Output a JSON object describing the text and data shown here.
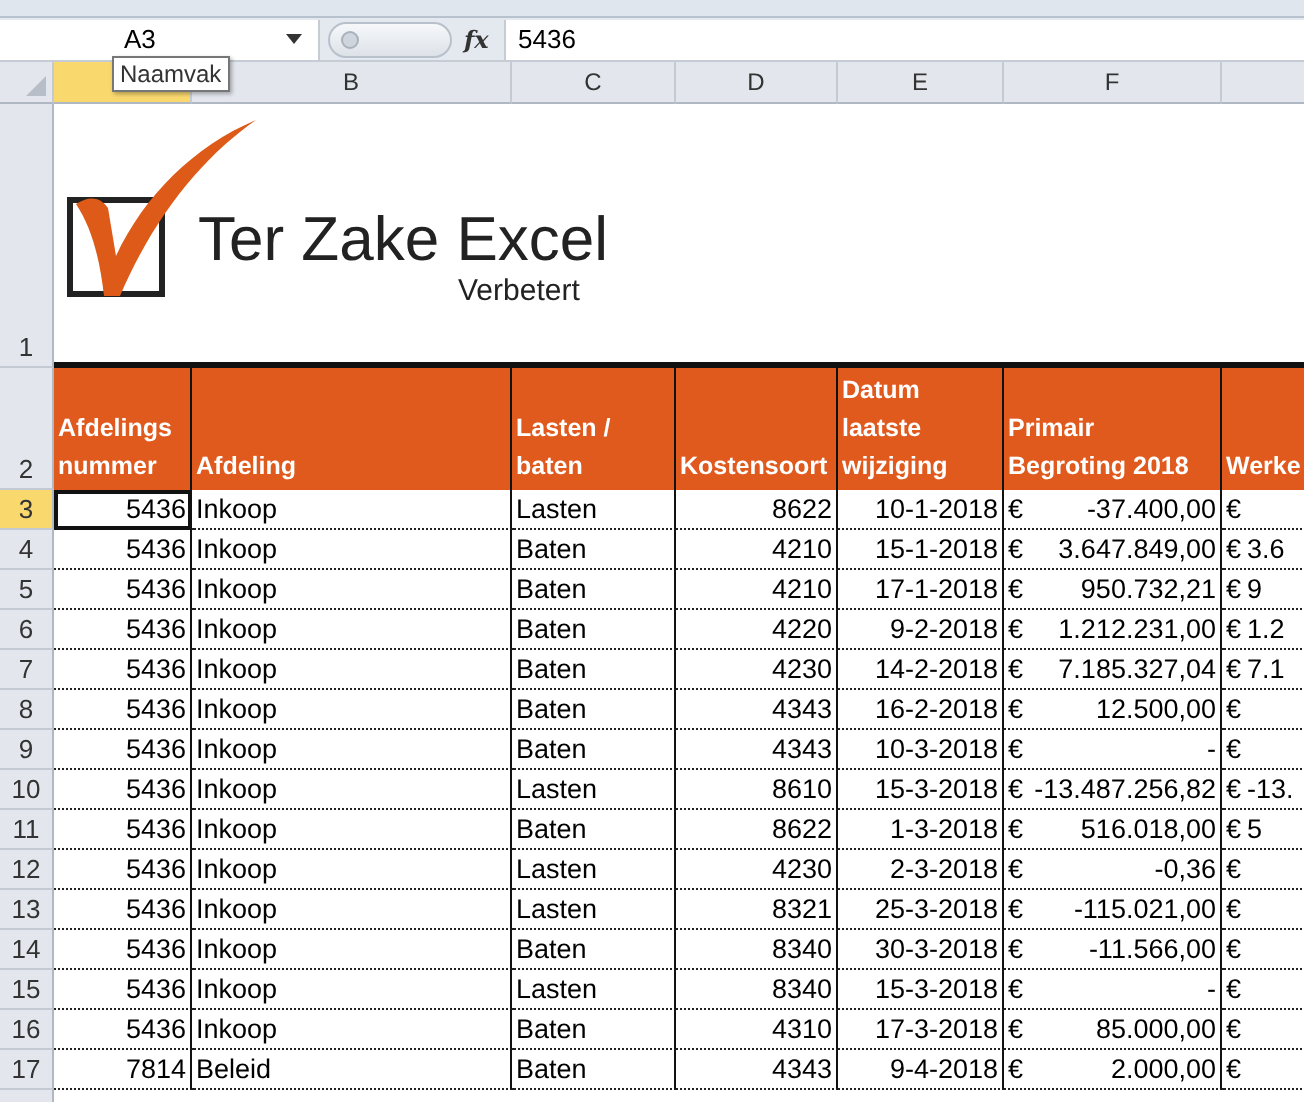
{
  "formula_bar": {
    "name_box": "A3",
    "function_label": "fx",
    "value": "5436"
  },
  "tooltip": "Naamvak",
  "columns": [
    {
      "selected": true
    },
    {
      "label": "B",
      "selected": false
    },
    {
      "label": "C",
      "selected": false
    },
    {
      "label": "D",
      "selected": false
    },
    {
      "label": "E",
      "selected": false
    },
    {
      "label": "F",
      "selected": false
    }
  ],
  "logo": {
    "row_number": "1",
    "title": "Ter Zake Excel",
    "tagline": "Verbetert"
  },
  "header_row": {
    "row_number": "2",
    "cells": [
      "Afdelings\nnummer",
      "Afdeling",
      "Lasten /\nbaten",
      "Kostensoort",
      "Datum\nlaatste\nwijziging",
      "Primair\nBegroting 2018",
      "Werke"
    ]
  },
  "rows": [
    {
      "number": "3",
      "selected": true,
      "cells": [
        "5436",
        "Inkoop",
        "Lasten",
        "8622",
        "10-1-2018",
        "€",
        "-37.400,00",
        "€",
        ""
      ]
    },
    {
      "number": "4",
      "selected": false,
      "cells": [
        "5436",
        "Inkoop",
        "Baten",
        "4210",
        "15-1-2018",
        "€",
        "3.647.849,00",
        "€",
        "3.6"
      ]
    },
    {
      "number": "5",
      "selected": false,
      "cells": [
        "5436",
        "Inkoop",
        "Baten",
        "4210",
        "17-1-2018",
        "€",
        "950.732,21",
        "€",
        "9"
      ]
    },
    {
      "number": "6",
      "selected": false,
      "cells": [
        "5436",
        "Inkoop",
        "Baten",
        "4220",
        "9-2-2018",
        "€",
        "1.212.231,00",
        "€",
        "1.2"
      ]
    },
    {
      "number": "7",
      "selected": false,
      "cells": [
        "5436",
        "Inkoop",
        "Baten",
        "4230",
        "14-2-2018",
        "€",
        "7.185.327,04",
        "€",
        "7.1"
      ]
    },
    {
      "number": "8",
      "selected": false,
      "cells": [
        "5436",
        "Inkoop",
        "Baten",
        "4343",
        "16-2-2018",
        "€",
        "12.500,00",
        "€",
        ""
      ]
    },
    {
      "number": "9",
      "selected": false,
      "cells": [
        "5436",
        "Inkoop",
        "Baten",
        "4343",
        "10-3-2018",
        "€",
        "-",
        "€",
        ""
      ]
    },
    {
      "number": "10",
      "selected": false,
      "cells": [
        "5436",
        "Inkoop",
        "Lasten",
        "8610",
        "15-3-2018",
        "€",
        "-13.487.256,82",
        "€",
        "-13."
      ]
    },
    {
      "number": "11",
      "selected": false,
      "cells": [
        "5436",
        "Inkoop",
        "Baten",
        "8622",
        "1-3-2018",
        "€",
        "516.018,00",
        "€",
        "5"
      ]
    },
    {
      "number": "12",
      "selected": false,
      "cells": [
        "5436",
        "Inkoop",
        "Lasten",
        "4230",
        "2-3-2018",
        "€",
        "-0,36",
        "€",
        ""
      ]
    },
    {
      "number": "13",
      "selected": false,
      "cells": [
        "5436",
        "Inkoop",
        "Lasten",
        "8321",
        "25-3-2018",
        "€",
        "-115.021,00",
        "€",
        ""
      ]
    },
    {
      "number": "14",
      "selected": false,
      "cells": [
        "5436",
        "Inkoop",
        "Baten",
        "8340",
        "30-3-2018",
        "€",
        "-11.566,00",
        "€",
        ""
      ]
    },
    {
      "number": "15",
      "selected": false,
      "cells": [
        "5436",
        "Inkoop",
        "Lasten",
        "8340",
        "15-3-2018",
        "€",
        "-",
        "€",
        ""
      ]
    },
    {
      "number": "16",
      "selected": false,
      "cells": [
        "5436",
        "Inkoop",
        "Baten",
        "4310",
        "17-3-2018",
        "€",
        "85.000,00",
        "€",
        ""
      ]
    },
    {
      "number": "17",
      "selected": false,
      "cells": [
        "7814",
        "Beleid",
        "Baten",
        "4343",
        "9-4-2018",
        "€",
        "2.000,00",
        "€",
        ""
      ]
    }
  ]
}
